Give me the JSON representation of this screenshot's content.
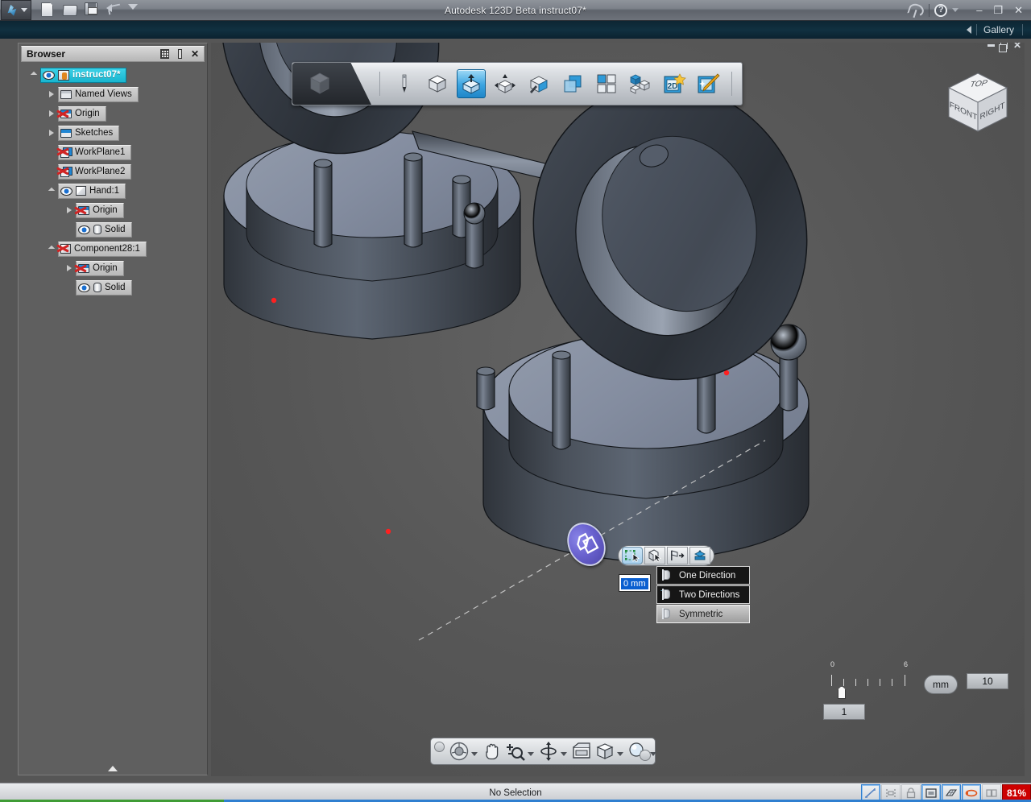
{
  "titlebar": {
    "app_title": "Autodesk 123D Beta",
    "document_title": "instruct07*",
    "full_title": "Autodesk 123D Beta   instruct07*",
    "quick_access": [
      {
        "name": "new-file-icon",
        "label": "New"
      },
      {
        "name": "open-file-icon",
        "label": "Open"
      },
      {
        "name": "save-file-icon",
        "label": "Save"
      },
      {
        "name": "undo-icon",
        "label": "Undo"
      },
      {
        "name": "customize-dropdown-icon",
        "label": "Customize"
      }
    ],
    "right_icons": [
      {
        "name": "satellite-dish-icon",
        "label": "Connect"
      },
      {
        "name": "help-icon",
        "label": "?"
      }
    ],
    "window_buttons": {
      "minimize": "–",
      "maximize": "❐",
      "close": "✕"
    }
  },
  "gallery_bar": {
    "label": "Gallery",
    "collapse_arrow": "◀"
  },
  "browser": {
    "title": "Browser",
    "header_icons": [
      {
        "name": "filter-icon"
      },
      {
        "name": "dock-pin-icon"
      },
      {
        "name": "close-panel-icon",
        "glyph": "✕"
      }
    ],
    "tree": [
      {
        "label": "instruct07*",
        "indent": 0,
        "expander": "open",
        "icons": [
          "eye",
          "doc"
        ],
        "selected": true
      },
      {
        "label": "Named Views",
        "indent": 1,
        "expander": "closed",
        "icons": [
          "folder"
        ],
        "selected": false
      },
      {
        "label": "Origin",
        "indent": 1,
        "expander": "closed",
        "icons": [
          "x-folder"
        ],
        "selected": false
      },
      {
        "label": "Sketches",
        "indent": 1,
        "expander": "closed",
        "icons": [
          "folder-blue"
        ],
        "selected": false
      },
      {
        "label": "WorkPlane1",
        "indent": 1,
        "expander": "none",
        "icons": [
          "x-plane"
        ],
        "selected": false
      },
      {
        "label": "WorkPlane2",
        "indent": 1,
        "expander": "none",
        "icons": [
          "x-plane"
        ],
        "selected": false
      },
      {
        "label": "Hand:1",
        "indent": 1,
        "expander": "open",
        "icons": [
          "eye",
          "cube"
        ],
        "selected": false
      },
      {
        "label": "Origin",
        "indent": 2,
        "expander": "closed",
        "icons": [
          "x-folder"
        ],
        "selected": false
      },
      {
        "label": "Solid",
        "indent": 2,
        "expander": "none",
        "icons": [
          "eye",
          "cyl"
        ],
        "selected": false
      },
      {
        "label": "Component28:1",
        "indent": 1,
        "expander": "open",
        "icons": [
          "x-cube"
        ],
        "selected": false
      },
      {
        "label": "Origin",
        "indent": 2,
        "expander": "closed",
        "icons": [
          "x-folder"
        ],
        "selected": false
      },
      {
        "label": "Solid",
        "indent": 2,
        "expander": "none",
        "icons": [
          "eye",
          "cyl"
        ],
        "selected": false
      }
    ]
  },
  "main_toolbar": {
    "logo_name": "123d-cube-logo",
    "buttons": [
      {
        "name": "sketch-tool",
        "label": "Sketch",
        "active": false
      },
      {
        "name": "primitives-tool",
        "label": "Primitives",
        "active": false
      },
      {
        "name": "construct-tool",
        "label": "Construct",
        "active": true
      },
      {
        "name": "modify-tool",
        "label": "Modify",
        "active": false
      },
      {
        "name": "pattern-tool",
        "label": "Pattern",
        "active": false
      },
      {
        "name": "combine-tool",
        "label": "Combine",
        "active": false
      },
      {
        "name": "grid-tool",
        "label": "Grid Snap",
        "active": false
      },
      {
        "name": "assemble-tool",
        "label": "Assemble",
        "active": false
      },
      {
        "name": "twod-tool",
        "label": "2D",
        "active": false
      },
      {
        "name": "magic-wand-tool",
        "label": "Smart Tools",
        "active": false
      }
    ]
  },
  "viewcube": {
    "top": "TOP",
    "front": "FRONT",
    "right": "RIGHT"
  },
  "viewport_window_buttons": {
    "minimize": "–",
    "restore": "❐",
    "close": "✕"
  },
  "extrude_widget": {
    "manipulator_name": "extrude-manipulator-disc",
    "manipulator_color": "#6a62cf",
    "mini_toolbar": [
      {
        "name": "select-profile-button",
        "active": true
      },
      {
        "name": "select-solid-button",
        "active": false
      },
      {
        "name": "extrude-direction-button",
        "active": false
      },
      {
        "name": "extrude-operation-button",
        "active": false
      }
    ],
    "value_field": {
      "value": "0 mm",
      "name": "extrude-distance-field"
    },
    "menu": [
      {
        "label": "One Direction",
        "highlighted": false
      },
      {
        "label": "Two Directions",
        "highlighted": false
      },
      {
        "label": "Symmetric",
        "highlighted": true
      }
    ]
  },
  "ruler": {
    "tick_labels": [
      "0",
      "6"
    ],
    "unit": "mm",
    "snap_value": "1",
    "grid_value": "10"
  },
  "nav_toolbar": [
    {
      "name": "steering-wheel-icon",
      "label": "SteeringWheels",
      "caret": true
    },
    {
      "name": "pan-hand-icon",
      "label": "Pan",
      "caret": false
    },
    {
      "name": "zoom-icon",
      "label": "Zoom",
      "caret": true
    },
    {
      "name": "orbit-icon",
      "label": "Orbit",
      "caret": true
    },
    {
      "name": "look-icon",
      "label": "Look",
      "caret": false
    },
    {
      "name": "view-box-icon",
      "label": "Views",
      "caret": true
    },
    {
      "name": "visual-style-icon",
      "label": "Visual Style",
      "caret": true
    }
  ],
  "statusbar": {
    "message": "No Selection",
    "toggles": [
      {
        "name": "snap-toggle",
        "active": true
      },
      {
        "name": "constraint-toggle",
        "active": false
      },
      {
        "name": "lock-toggle",
        "active": false
      },
      {
        "name": "workplane-toggle",
        "active": true
      },
      {
        "name": "grid-toggle",
        "active": true
      },
      {
        "name": "orbit-toggle",
        "active": true
      },
      {
        "name": "display-toggle",
        "active": false
      }
    ],
    "progress_badge": "81%",
    "progress_color": "#cc0000"
  },
  "theme": {
    "viewport_bg": "#565656",
    "model_light": "#8a93a3",
    "model_dark": "#3a4048",
    "accent_blue": "#2f7fd0",
    "selection_cyan": "#18b5cf",
    "title_bar": "#7d828a"
  }
}
